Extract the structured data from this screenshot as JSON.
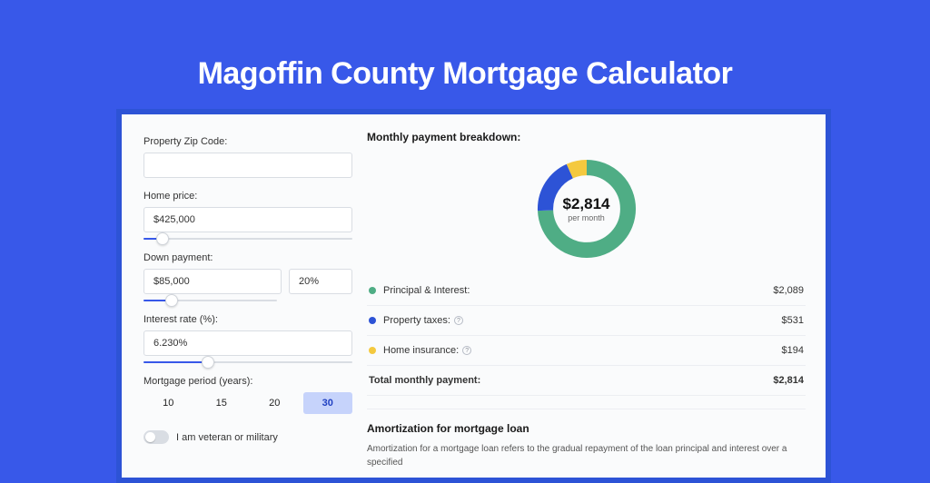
{
  "page": {
    "title": "Magoffin County Mortgage Calculator"
  },
  "form": {
    "zip": {
      "label": "Property Zip Code:",
      "value": ""
    },
    "home_price": {
      "label": "Home price:",
      "value": "$425,000",
      "slider_pct": 9
    },
    "down_payment": {
      "label": "Down payment:",
      "amount": "$85,000",
      "pct": "20%",
      "slider_pct": 21
    },
    "interest": {
      "label": "Interest rate (%):",
      "value": "6.230%",
      "slider_pct": 31
    },
    "period": {
      "label": "Mortgage period (years):",
      "options": [
        "10",
        "15",
        "20",
        "30"
      ],
      "active_index": 3
    },
    "veteran": {
      "label": "I am veteran or military",
      "on": false
    }
  },
  "breakdown": {
    "title": "Monthly payment breakdown:",
    "center_amount": "$2,814",
    "center_sub": "per month",
    "items": [
      {
        "name": "Principal & Interest:",
        "value": "$2,089",
        "color": "#4fad85",
        "info": false
      },
      {
        "name": "Property taxes:",
        "value": "$531",
        "color": "#2d53d6",
        "info": true
      },
      {
        "name": "Home insurance:",
        "value": "$194",
        "color": "#f4c93f",
        "info": true
      }
    ],
    "total": {
      "name": "Total monthly payment:",
      "value": "$2,814"
    }
  },
  "amortization": {
    "title": "Amortization for mortgage loan",
    "body": "Amortization for a mortgage loan refers to the gradual repayment of the loan principal and interest over a specified"
  },
  "chart_data": {
    "type": "pie",
    "title": "Monthly payment breakdown",
    "series": [
      {
        "name": "Principal & Interest",
        "value": 2089,
        "color": "#4fad85"
      },
      {
        "name": "Property taxes",
        "value": 531,
        "color": "#2d53d6"
      },
      {
        "name": "Home insurance",
        "value": 194,
        "color": "#f4c93f"
      }
    ],
    "total": 2814,
    "center_label": "$2,814 per month"
  }
}
